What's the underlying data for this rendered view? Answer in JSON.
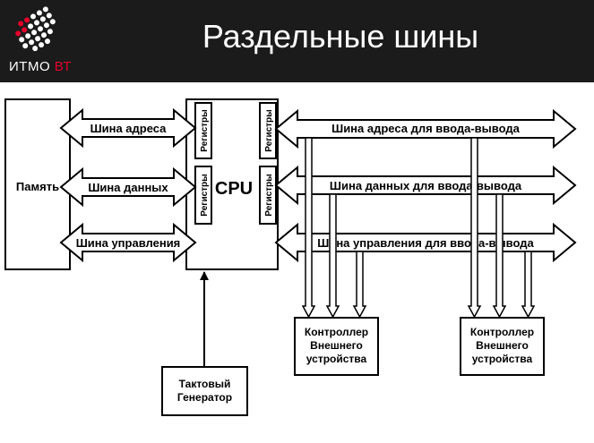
{
  "header": {
    "title": "Раздельные шины",
    "logo_text": "ИТМО",
    "logo_accent": "ВТ",
    "logo_color": "#e4002b",
    "background": "#1b1b1b"
  },
  "diagram": {
    "memory_label": "Память",
    "cpu_label": "CPU",
    "registers_label": "Регистры",
    "clock_label_line1": "Тактовый",
    "clock_label_line2": "Генератор",
    "controller_line1": "Контроллер",
    "controller_line2": "Внешнего",
    "controller_line3": "устройства",
    "buses": {
      "address": "Шина адреса",
      "data": "Шина данных",
      "control": "Шина управления",
      "io_address": "Шина адреса для ввода-вывода",
      "io_data": "Шина данных для ввода-вывода",
      "io_control": "Шина управления для ввода-вывода"
    }
  }
}
